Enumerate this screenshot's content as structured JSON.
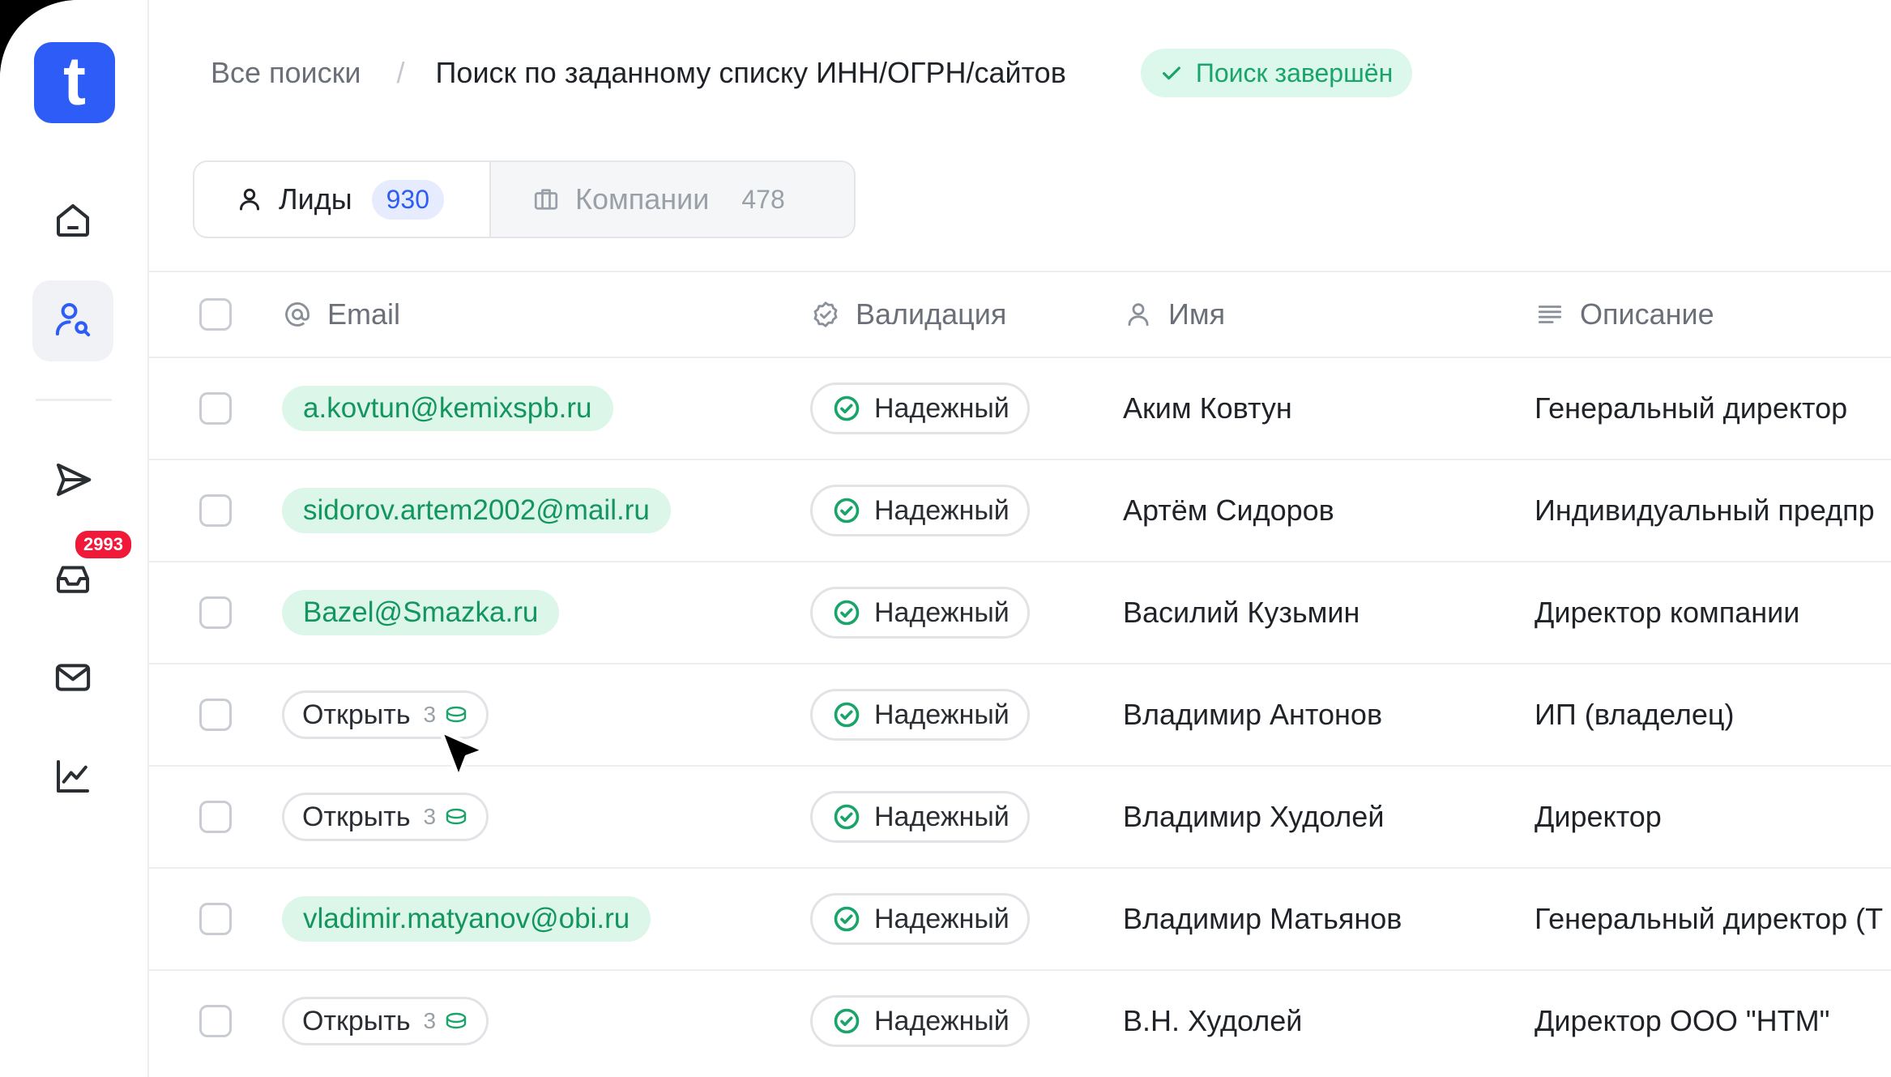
{
  "sidebar": {
    "logo_letter": "t",
    "items": [
      {
        "icon": "home-icon"
      },
      {
        "icon": "user-search-icon",
        "active": true
      },
      {
        "icon": "send-icon"
      },
      {
        "icon": "inbox-icon",
        "badge": "2993"
      },
      {
        "icon": "mail-icon"
      },
      {
        "icon": "chart-line-icon"
      }
    ]
  },
  "header": {
    "breadcrumb_root": "Все поиски",
    "breadcrumb_separator": "/",
    "breadcrumb_current": "Поиск по заданному списку ИНН/ОГРН/сайтов",
    "status": "Поиск завершён"
  },
  "tabs": [
    {
      "label": "Лиды",
      "count": "930",
      "icon": "user-icon",
      "active": true
    },
    {
      "label": "Компании",
      "count": "478",
      "icon": "briefcase-icon",
      "active": false
    }
  ],
  "table": {
    "columns": {
      "email": "Email",
      "validation": "Валидация",
      "name": "Имя",
      "description": "Описание"
    },
    "open_label": "Открыть",
    "rows": [
      {
        "email": "a.kovtun@kemixspb.ru",
        "open_cost": null,
        "validation": "Надежный",
        "name": "Аким Ковтун",
        "description": "Генеральный директор"
      },
      {
        "email": "sidorov.artem2002@mail.ru",
        "open_cost": null,
        "validation": "Надежный",
        "name": "Артём Сидоров",
        "description": "Индивидуальный предпр"
      },
      {
        "email": "Bazel@Smazka.ru",
        "open_cost": null,
        "validation": "Надежный",
        "name": "Василий Кузьмин",
        "description": "Директор компании"
      },
      {
        "email": null,
        "open_cost": "3",
        "validation": "Надежный",
        "name": "Владимир Антонов",
        "description": "ИП (владелец)"
      },
      {
        "email": null,
        "open_cost": "3",
        "validation": "Надежный",
        "name": "Владимир Худолей",
        "description": "Директор"
      },
      {
        "email": "vladimir.matyanov@obi.ru",
        "open_cost": null,
        "validation": "Надежный",
        "name": "Владимир Матьянов",
        "description": "Генеральный директор (Т"
      },
      {
        "email": null,
        "open_cost": "3",
        "validation": "Надежный",
        "name": "В.Н. Худолей",
        "description": "Директор ООО \"НТМ\""
      }
    ]
  },
  "colors": {
    "brand": "#2d5cf6",
    "success": "#19a46a",
    "success_bg": "#dcf7eb",
    "badge": "#f0193a"
  }
}
